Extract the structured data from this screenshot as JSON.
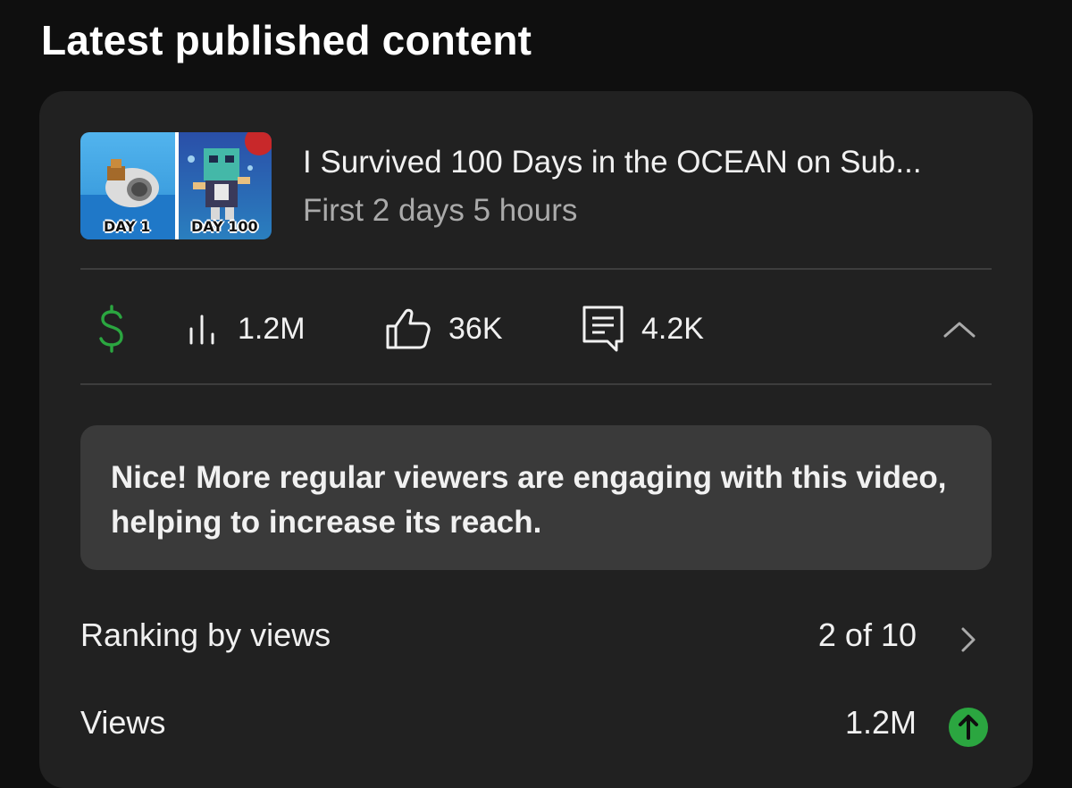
{
  "section": {
    "title": "Latest published content"
  },
  "video": {
    "title": "I Survived 100 Days in the OCEAN on Sub...",
    "subtitle": "First 2 days 5 hours",
    "thumbnail": {
      "left_label": "DAY 1",
      "right_label": "DAY 100"
    }
  },
  "stats": {
    "monetization_icon": "dollar-icon",
    "views": "1.2M",
    "likes": "36K",
    "comments": "4.2K"
  },
  "banner": {
    "text": "Nice! More regular viewers are engaging with this video, helping to increase its reach."
  },
  "metrics": [
    {
      "label": "Ranking by views",
      "value": "2 of 10",
      "icon": "chevron-right-icon"
    },
    {
      "label": "Views",
      "value": "1.2M",
      "icon": "arrow-up-circle-icon"
    }
  ],
  "colors": {
    "background": "#0f0f0f",
    "card": "#212121",
    "banner": "#3a3a3a",
    "accent_green": "#2ba640",
    "muted_text": "#aaaaaa"
  }
}
